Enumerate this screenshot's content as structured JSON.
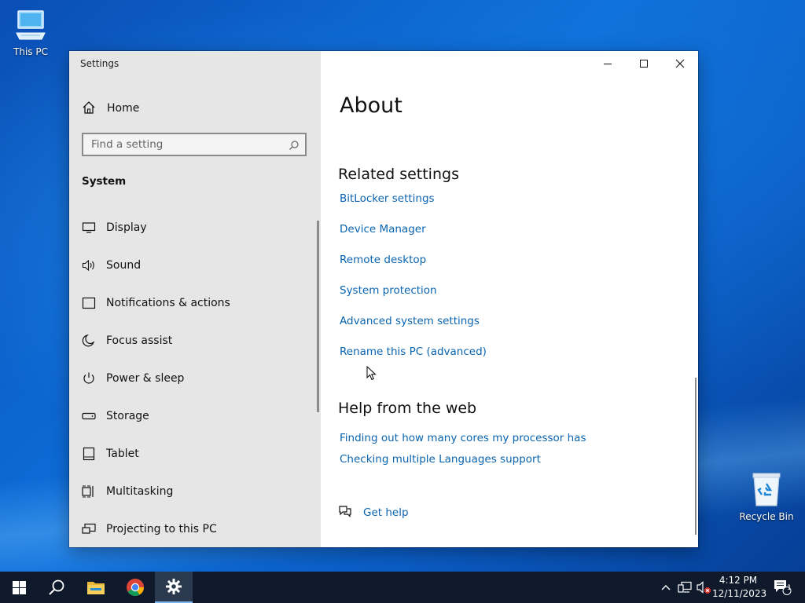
{
  "desktop": {
    "icons": [
      {
        "label": "This PC",
        "icon": "this-pc-icon"
      },
      {
        "label": "Recycle Bin",
        "icon": "recycle-bin-icon"
      }
    ]
  },
  "window": {
    "title": "Settings",
    "caption_buttons": [
      "minimize",
      "maximize",
      "close"
    ]
  },
  "sidebar": {
    "home_label": "Home",
    "search_placeholder": "Find a setting",
    "section_title": "System",
    "items": [
      {
        "label": "Display",
        "icon": "display-icon"
      },
      {
        "label": "Sound",
        "icon": "sound-icon"
      },
      {
        "label": "Notifications & actions",
        "icon": "notifications-icon"
      },
      {
        "label": "Focus assist",
        "icon": "focus-assist-icon"
      },
      {
        "label": "Power & sleep",
        "icon": "power-icon"
      },
      {
        "label": "Storage",
        "icon": "storage-icon"
      },
      {
        "label": "Tablet",
        "icon": "tablet-icon"
      },
      {
        "label": "Multitasking",
        "icon": "multitasking-icon"
      },
      {
        "label": "Projecting to this PC",
        "icon": "projecting-icon"
      }
    ]
  },
  "content": {
    "page_title": "About",
    "related_settings": {
      "heading": "Related settings",
      "links": [
        "BitLocker settings",
        "Device Manager",
        "Remote desktop",
        "System protection",
        "Advanced system settings",
        "Rename this PC (advanced)"
      ]
    },
    "help_from_web": {
      "heading": "Help from the web",
      "links": [
        "Finding out how many cores my processor has",
        "Checking multiple Languages support"
      ]
    },
    "get_help_label": "Get help"
  },
  "taskbar": {
    "apps": [
      "start-icon",
      "search-icon",
      "file-explorer-icon",
      "chrome-icon",
      "settings-icon"
    ],
    "clock": {
      "time": "4:12 PM",
      "date": "12/11/2023"
    },
    "notification_count": "1"
  },
  "colors": {
    "link": "#0a64b0",
    "sidebar_bg": "#e6e6e6",
    "taskbar_bg": "#0e1a2b"
  }
}
